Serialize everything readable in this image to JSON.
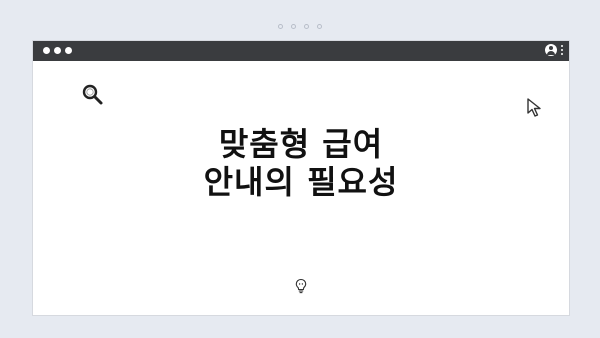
{
  "pager": {
    "dots": 4
  },
  "window": {
    "titlebar_color": "#3a3c3f",
    "icons": [
      "user-icon",
      "kebab-menu-icon"
    ]
  },
  "content": {
    "headline_line1": "맞춤형 급여",
    "headline_line2": "안내의 필요성",
    "icons": [
      "search-icon",
      "cursor-arrow-icon",
      "lightbulb-icon"
    ]
  },
  "colors": {
    "background": "#e6eaf1",
    "card": "#ffffff",
    "text": "#111111"
  }
}
